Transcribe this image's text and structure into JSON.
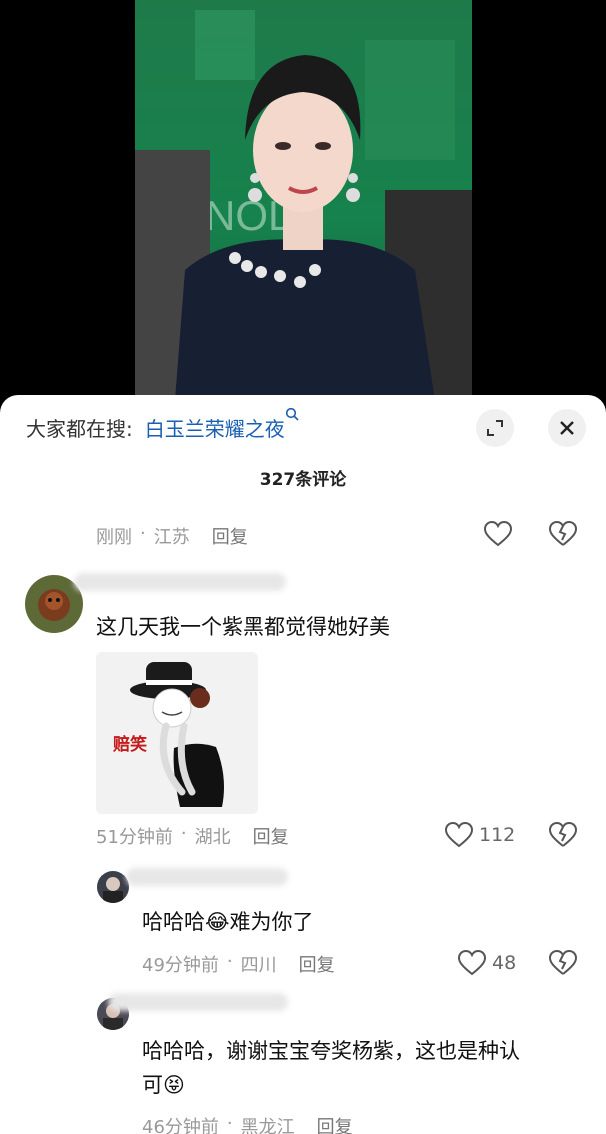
{
  "search": {
    "prefix": "大家都在搜:",
    "term": "白玉兰荣耀之夜"
  },
  "comments_title": "327条评论",
  "top_fragment": {
    "time": "刚刚",
    "location": "江苏",
    "reply": "回复"
  },
  "comments": [
    {
      "text": "这几天我一个紫黑都觉得她好美",
      "sticker_label": "赔笑",
      "time": "51分钟前",
      "location": "湖北",
      "reply": "回复",
      "likes": "112"
    },
    {
      "text": "哈哈哈😂难为你了",
      "time": "49分钟前",
      "location": "四川",
      "reply": "回复",
      "likes": "48"
    },
    {
      "text_line1": "哈哈哈，谢谢宝宝夸奖杨紫，这也是种认",
      "text_line2": "可😝",
      "time": "46分钟前",
      "location": "黑龙江",
      "reply": "回复"
    }
  ],
  "colors": {
    "search_term": "#1a5fb4",
    "meta_text": "#999999",
    "sticker_label": "#c41a1a"
  },
  "icons": [
    "search-icon",
    "expand-icon",
    "close-icon",
    "heart-icon",
    "broken-heart-icon"
  ]
}
